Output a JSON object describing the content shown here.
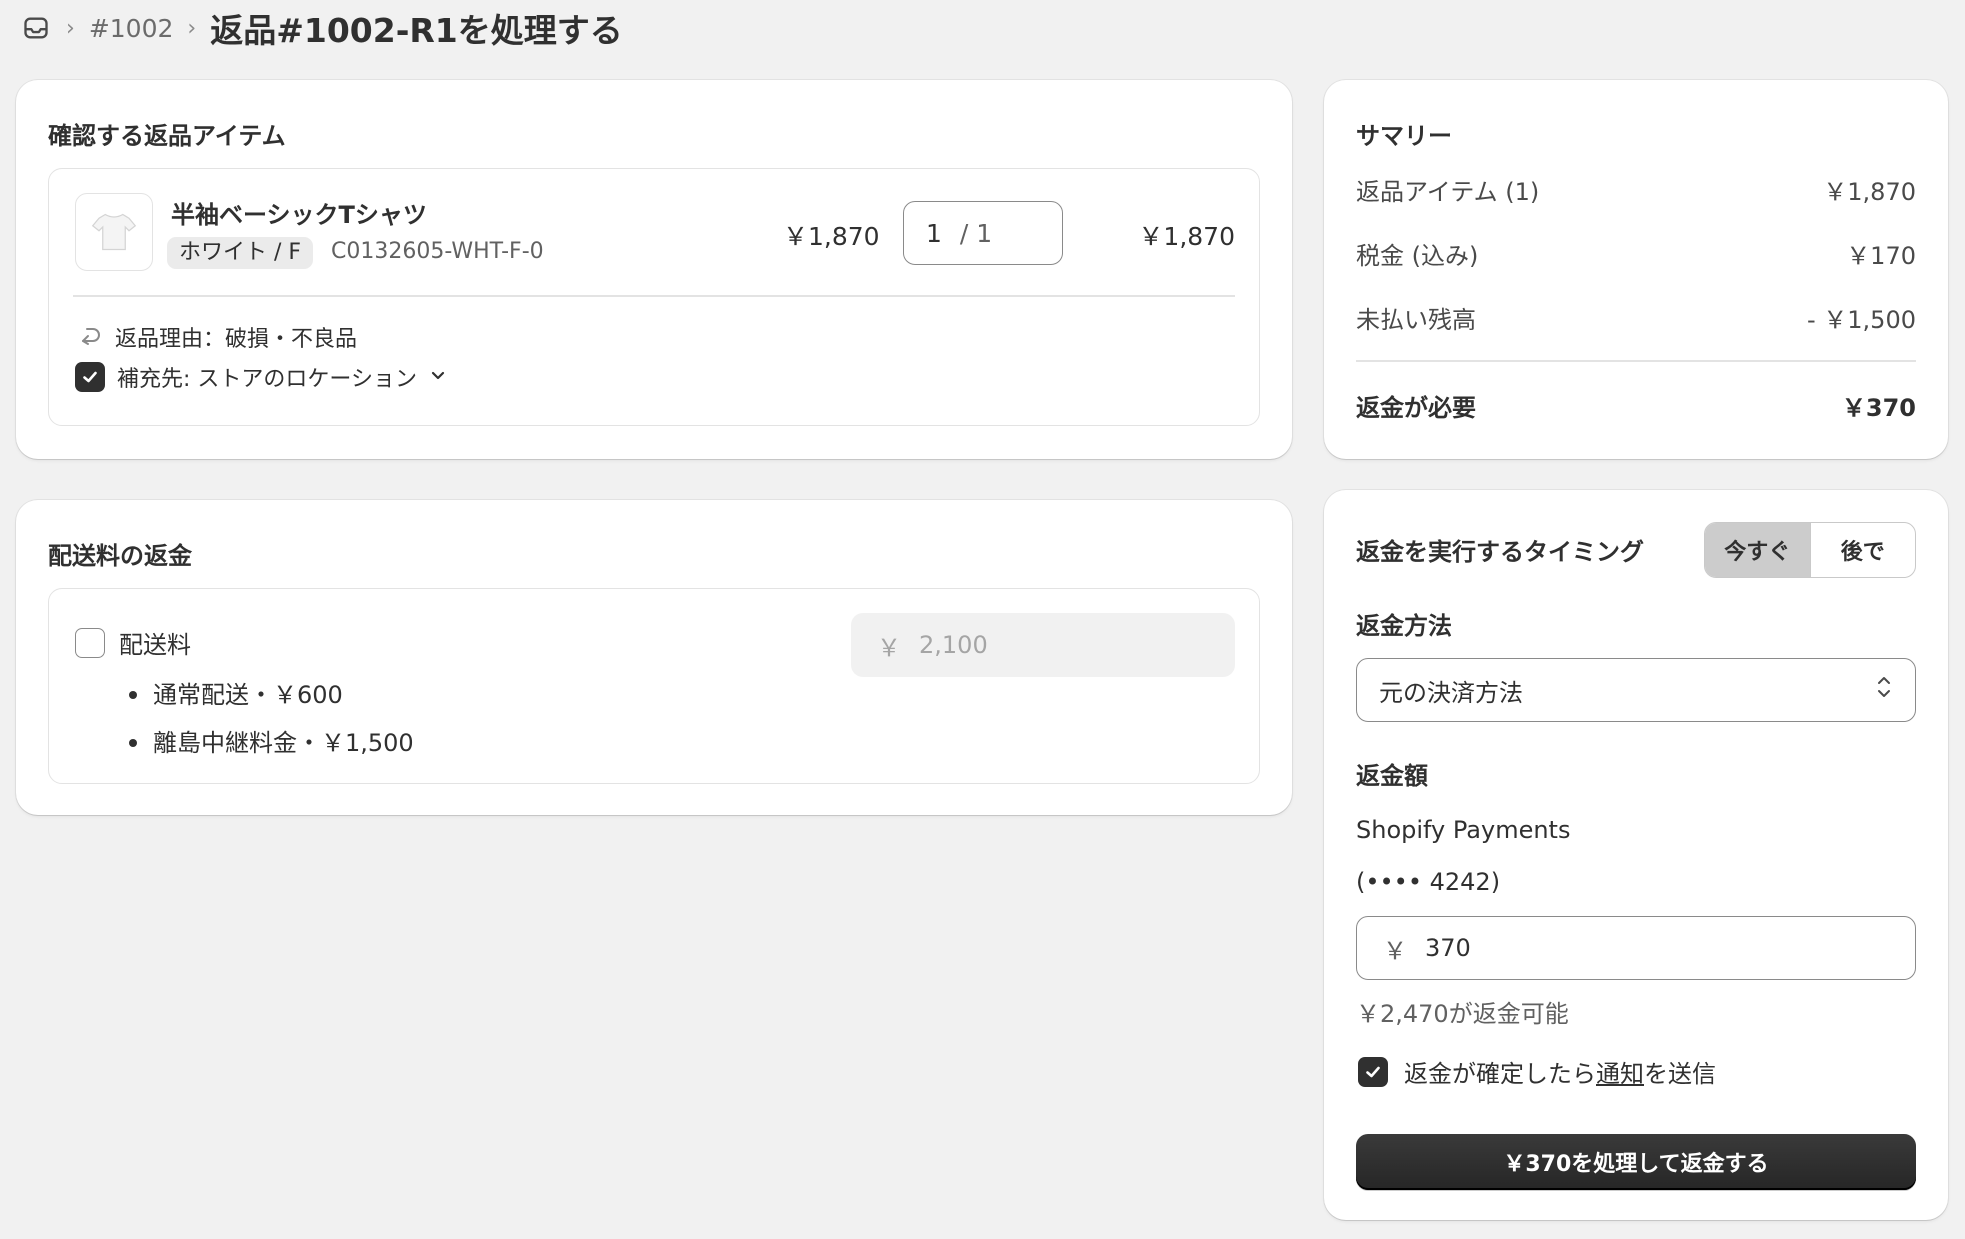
{
  "breadcrumb": {
    "parent_label": "#1002",
    "title": "返品#1002-R1を処理する",
    "icon": "inbox-icon"
  },
  "return_items": {
    "title": "確認する返品アイテム",
    "item": {
      "name": "半袖ベーシックTシャツ",
      "variant": "ホワイト / F",
      "sku": "C0132605-WHT-F-0",
      "unit_price": "￥1,870",
      "quantity": "1",
      "quantity_max": "/ 1",
      "line_total": "￥1,870",
      "reason": "返品理由：破損・不良品",
      "restock_label": "補充先: ストアのロケーション",
      "restock_checked": true
    }
  },
  "shipping": {
    "title": "配送料の返金",
    "checkbox_label": "配送料",
    "lines": [
      "通常配送・￥600",
      "離島中継料金・￥1,500"
    ],
    "currency_symbol": "￥",
    "amount_placeholder": "2,100"
  },
  "summary": {
    "title": "サマリー",
    "rows": [
      {
        "label": "返品アイテム (1)",
        "value": "￥1,870"
      },
      {
        "label": "税金 (込み)",
        "value": "￥170"
      },
      {
        "label": "未払い残高",
        "value": "- ￥1,500"
      }
    ],
    "total_label": "返金が必要",
    "total_value": "￥370"
  },
  "refund": {
    "timing_label": "返金を実行するタイミング",
    "timing_options": [
      "今すぐ",
      "後で"
    ],
    "method_label": "返金方法",
    "method_value": "元の決済方法",
    "amount_label": "返金額",
    "provider": "Shopify Payments",
    "card_digits": "(•••• 4242)",
    "currency_symbol": "￥",
    "amount_value": "370",
    "available_text": "￥2,470が返金可能",
    "notify_prefix": "返金が確定したら",
    "notify_link": "通知",
    "notify_suffix": "を送信",
    "submit_label": "￥370を処理して返金する"
  },
  "colors": {
    "background": "#f1f1f1",
    "card": "#ffffff",
    "primary_button": "#303030",
    "text": "#303030"
  }
}
